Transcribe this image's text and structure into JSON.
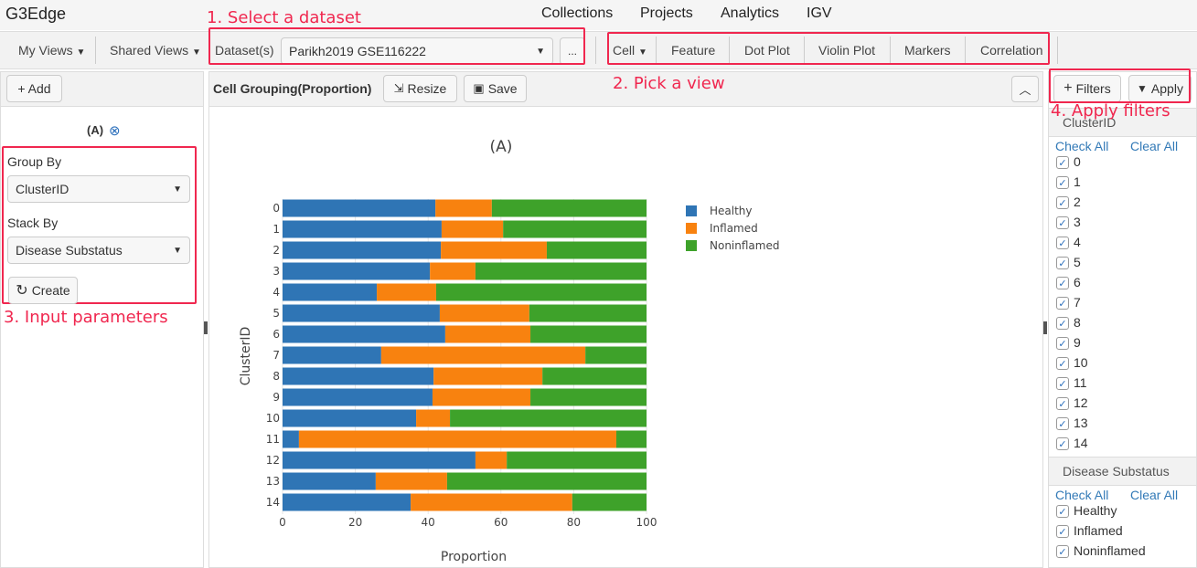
{
  "app": {
    "title": "G3Edge",
    "nav": [
      "Collections",
      "Projects",
      "Analytics",
      "IGV"
    ]
  },
  "toolbar": {
    "my_views": "My Views",
    "shared_views": "Shared Views",
    "dataset_label": "Dataset(s)",
    "dataset_value": "Parikh2019 GSE116222",
    "more": "...",
    "tabs": [
      "Cell",
      "Feature",
      "Dot Plot",
      "Violin Plot",
      "Markers",
      "Correlation"
    ]
  },
  "annotations": {
    "a1": "1. Select a dataset",
    "a2": "2. Pick a view",
    "a3": "3. Input parameters",
    "a4": "4. Apply filters"
  },
  "left": {
    "add": "+ Add",
    "item_label": "(A)",
    "group_by_label": "Group By",
    "group_by_value": "ClusterID",
    "stack_by_label": "Stack By",
    "stack_by_value": "Disease Substatus",
    "create": "Create"
  },
  "center": {
    "title": "Cell Grouping(Proportion)",
    "resize": "Resize",
    "save": "Save"
  },
  "right": {
    "filters": "Filters",
    "apply": "Apply",
    "check_all": "Check All",
    "clear_all": "Clear All",
    "groups": [
      {
        "name": "ClusterID",
        "items": [
          "0",
          "1",
          "2",
          "3",
          "4",
          "5",
          "6",
          "7",
          "8",
          "9",
          "10",
          "11",
          "12",
          "13",
          "14"
        ],
        "checked": true
      },
      {
        "name": "Disease Substatus",
        "items": [
          "Healthy",
          "Inflamed",
          "Noninflamed"
        ],
        "checked": true
      }
    ]
  },
  "colors": {
    "Healthy": "#2f75b5",
    "Inflamed": "#f8820f",
    "Noninflamed": "#3ea22a",
    "annotation": "#f0274f",
    "link": "#337ab7"
  },
  "chart_data": {
    "type": "bar",
    "orientation": "horizontal",
    "stacked": true,
    "title": "(A)",
    "xlabel": "Proportion",
    "ylabel": "ClusterID",
    "xlim": [
      0,
      100
    ],
    "xticks": [
      "0",
      "20",
      "40",
      "60",
      "80",
      "100"
    ],
    "categories": [
      "0",
      "1",
      "2",
      "3",
      "4",
      "5",
      "6",
      "7",
      "8",
      "9",
      "10",
      "11",
      "12",
      "13",
      "14"
    ],
    "legend_position": "right",
    "series": [
      {
        "name": "Healthy",
        "values": [
          42.0,
          43.7,
          43.5,
          40.5,
          25.9,
          43.2,
          44.7,
          27.1,
          41.5,
          41.2,
          36.7,
          4.5,
          53.0,
          25.6,
          35.2
        ]
      },
      {
        "name": "Inflamed",
        "values": [
          15.5,
          16.9,
          29.1,
          12.5,
          16.3,
          24.6,
          23.4,
          56.1,
          29.9,
          26.9,
          9.3,
          87.2,
          8.6,
          19.6,
          44.4
        ]
      },
      {
        "name": "Noninflamed",
        "values": [
          42.5,
          39.4,
          27.4,
          47.0,
          57.8,
          32.2,
          31.9,
          16.8,
          28.6,
          31.9,
          54.0,
          8.3,
          38.4,
          54.8,
          20.4
        ]
      }
    ]
  }
}
